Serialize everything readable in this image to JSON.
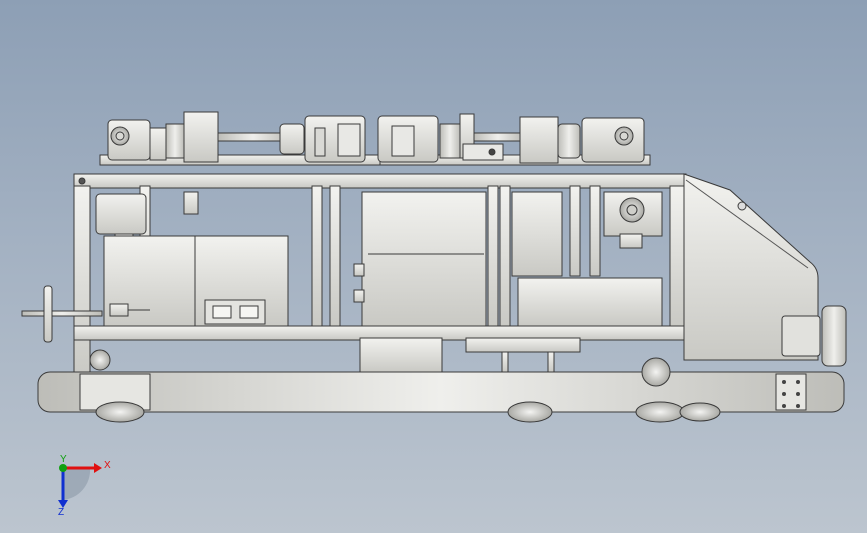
{
  "triad": {
    "x_label": "X",
    "y_label": "Y",
    "z_label": "Z",
    "x_color": "#e01010",
    "y_color": "#10a010",
    "z_color": "#1030d0"
  },
  "palette": {
    "metal_light": "#e6e6e2",
    "metal_mid": "#cfcfca",
    "metal_dark": "#9a9a95",
    "edge": "#3a3a3a"
  }
}
